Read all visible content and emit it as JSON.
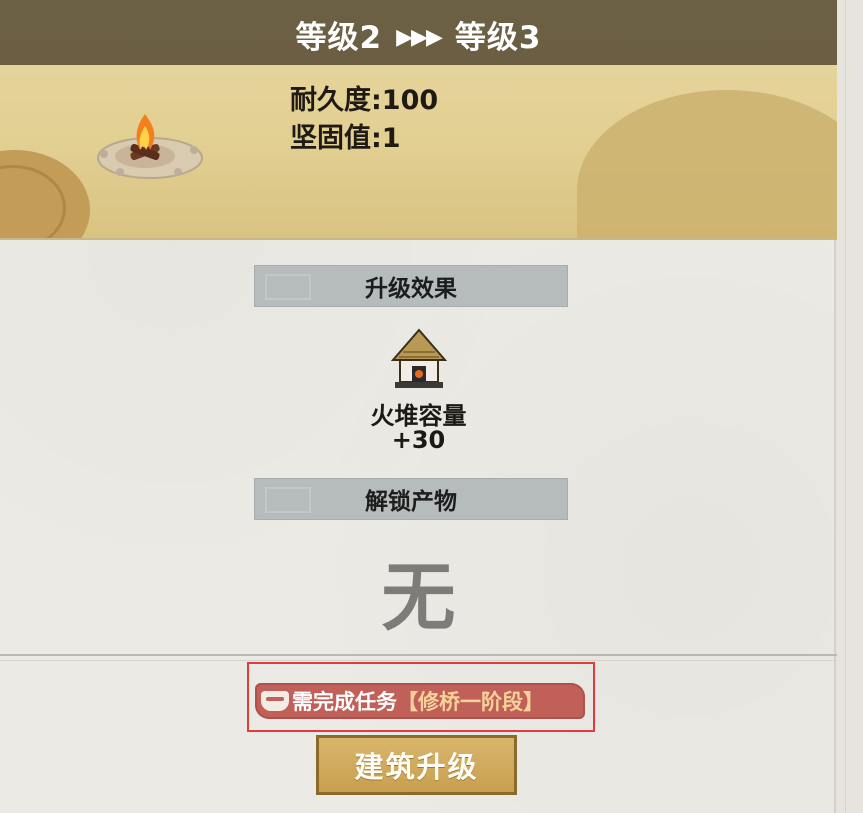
{
  "header": {
    "from_level": "等级2",
    "arrows": "▶▶▶",
    "to_level": "等级3"
  },
  "stats": {
    "durability": "耐久度:100",
    "solidity": "坚固值:1"
  },
  "upgrade_effect": {
    "title": "升级效果",
    "name": "火堆容量",
    "value": "+30"
  },
  "unlock": {
    "title": "解锁产物",
    "value": "无"
  },
  "requirement": {
    "text": "需完成任务",
    "task": "【修桥一阶段】"
  },
  "buttons": {
    "upgrade": "建筑升级"
  },
  "colors": {
    "header_bar": "#4f4430",
    "task_banner": "#c06058",
    "button": "#d2ad5f",
    "highlight_frame": "#e23b3b"
  }
}
